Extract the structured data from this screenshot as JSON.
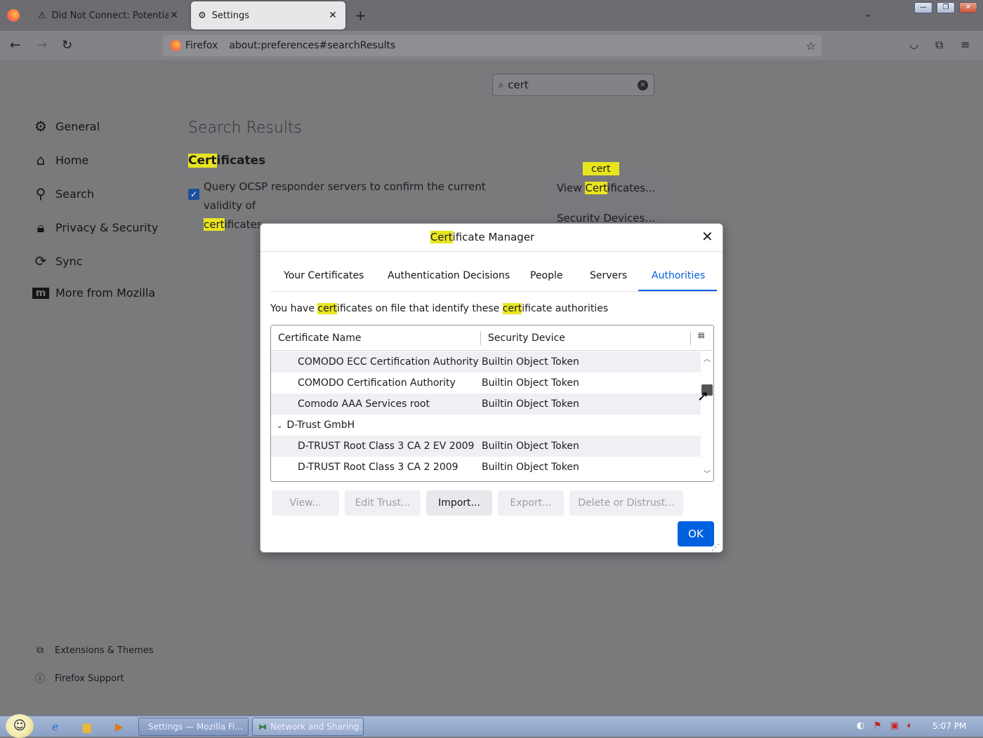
{
  "browser": {
    "tabs": [
      {
        "label": "Did Not Connect: Potential Sec",
        "icon": "warning-icon"
      },
      {
        "label": "Settings",
        "icon": "gear-icon"
      }
    ],
    "identity_label": "Firefox",
    "url": "about:preferences#searchResults",
    "window_buttons": [
      "minimize",
      "restore",
      "close"
    ]
  },
  "settings": {
    "search_value": "cert",
    "categories": [
      {
        "label": "General",
        "icon": "gear-icon"
      },
      {
        "label": "Home",
        "icon": "home-icon"
      },
      {
        "label": "Search",
        "icon": "search-icon"
      },
      {
        "label": "Privacy & Security",
        "icon": "lock-icon"
      },
      {
        "label": "Sync",
        "icon": "sync-icon"
      },
      {
        "label": "More from Mozilla",
        "icon": "mozilla-icon"
      }
    ],
    "results_title": "Search Results",
    "section_title_hl": "Cert",
    "section_title_rest": "ificates",
    "ocsp_text": "Query OCSP responder servers to confirm the current validity of",
    "ocsp_hl": "cert",
    "ocsp_rest": "ificates",
    "ocsp_checked": true,
    "tooltip": "cert",
    "view_pre": "View ",
    "view_hl": "Cert",
    "view_post": "ificates...",
    "security_devices": "Security Devices...",
    "footer": [
      {
        "label": "Extensions & Themes",
        "icon": "puzzle-icon"
      },
      {
        "label": "Firefox Support",
        "icon": "help-icon"
      }
    ]
  },
  "dialog": {
    "title_hl": "Cert",
    "title_rest": "ificate Manager",
    "tabs": [
      "Your Certificates",
      "Authentication Decisions",
      "People",
      "Servers",
      "Authorities"
    ],
    "active_tab": "Authorities",
    "desc_1": "You have ",
    "desc_hl1": "cert",
    "desc_2": "ificates on file that identify these ",
    "desc_hl2": "cert",
    "desc_3": "ificate authorities",
    "columns": [
      "Certificate Name",
      "Security Device"
    ],
    "rows": [
      {
        "name": "COMODO ECC Certification Authority",
        "device": "Builtin Object Token"
      },
      {
        "name": "COMODO Certification Authority",
        "device": "Builtin Object Token"
      },
      {
        "name": "Comodo AAA Services root",
        "device": "Builtin Object Token"
      },
      {
        "name": "D-Trust GmbH",
        "device": ""
      },
      {
        "name": "D-TRUST Root Class 3 CA 2 EV 2009",
        "device": "Builtin Object Token"
      },
      {
        "name": "D-TRUST Root Class 3 CA 2 2009",
        "device": "Builtin Object Token"
      }
    ],
    "buttons": {
      "view": "View...",
      "edit": "Edit Trust...",
      "import": "Import...",
      "export": "Export...",
      "delete": "Delete or Distrust...",
      "ok": "OK"
    }
  },
  "taskbar": {
    "tasks": [
      "Settings — Mozilla Fi...",
      "Network and Sharing..."
    ],
    "clock": "5:07 PM"
  }
}
